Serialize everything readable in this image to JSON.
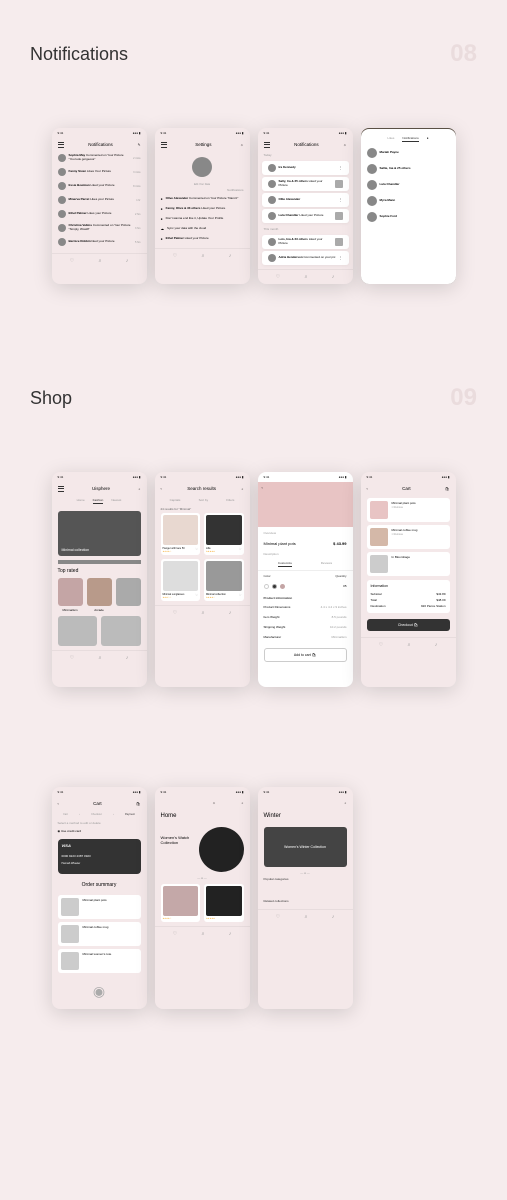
{
  "sections": {
    "notifications": {
      "title": "Notifications",
      "num": "08"
    },
    "shop": {
      "title": "Shop",
      "num": "09"
    }
  },
  "time": "9:41",
  "screens": {
    "notif1": {
      "title": "Notifications",
      "items": [
        {
          "name": "Sophia May",
          "action": "Commented on Your Picture \"You look gorgeous\"",
          "time": "2 mins"
        },
        {
          "name": "Fanny Siven",
          "action": "Likes Your Picture",
          "time": "3 mins"
        },
        {
          "name": "Essie Bowman",
          "action": "Liked your Picture",
          "time": "8 mins"
        },
        {
          "name": "Minerva Parret",
          "action": "Likes your Picture",
          "time": "1 hr"
        },
        {
          "name": "Ethel Palmer",
          "action": "Likes your Picture",
          "time": "2 hrs"
        },
        {
          "name": "Christina Vablos",
          "action": "Commented on Your Picture \"Simply, Wowlll\"",
          "time": "3 hrs"
        },
        {
          "name": "Bernice Robbin",
          "action": "liked your Picture",
          "time": "5 hrs"
        }
      ]
    },
    "settings": {
      "title": "Settings",
      "editBtn": "Edit Your Data",
      "sectionLabel": "Notifications",
      "items": [
        {
          "name": "Olive Alexander",
          "action": "Commented on Your Picture \"Damn!\""
        },
        {
          "name": "Fanny, Olive & 33 others",
          "action": "Liked your Picture"
        },
        {
          "action": "Don't wanna end like it, Update Your Profile"
        },
        {
          "action": "Sync your data with the cloud"
        },
        {
          "name": "Ethel Palmer",
          "action": "Liked your Picture"
        }
      ]
    },
    "notif2": {
      "title": "Notifications",
      "todayLabel": "Today",
      "monthLabel": "This month",
      "today": [
        {
          "name": "Ira Kennedy",
          "action": ""
        },
        {
          "name": "Sally, Ira & 25 others",
          "action": "Liked your Picture"
        },
        {
          "name": "Ollie Alexander",
          "action": ""
        },
        {
          "name": "Lula Chandler",
          "action": "Liked your Picture"
        }
      ],
      "month": [
        {
          "name": "Lois, Ina & 23 others",
          "action": "Liked your Picture"
        },
        {
          "name": "Adria Henderson",
          "action": "Commented on your pic"
        }
      ]
    },
    "profile": {
      "tabLikes": "Likes",
      "tabNotif": "Notifications",
      "users": [
        {
          "name": "Mariah Payne"
        },
        {
          "name": "Sallie, Ina & 25 others"
        },
        {
          "name": "Lula Chandler"
        },
        {
          "name": "Myra Mann"
        },
        {
          "name": "Sophie Ford"
        }
      ]
    },
    "shopHome": {
      "brand": "Uisphere",
      "tabs": [
        "Home",
        "Fashion",
        "Newest"
      ],
      "heroTitle": "Minimal collection",
      "topRated": "Top rated",
      "categories": [
        "Minimalism",
        "Arcade"
      ]
    },
    "search": {
      "title": "Search results",
      "filters": [
        "Capitals",
        "Sort by",
        "Filters"
      ],
      "resultText": "24 results for \"Minimal\"",
      "products": [
        {
          "name": "Hanger with lace 50"
        },
        {
          "name": "Lilla"
        },
        {
          "name": "Minimal sunglasses"
        },
        {
          "name": "Minimal collection"
        }
      ]
    },
    "product": {
      "overline": "Overview",
      "name": "Minimal plant pots",
      "price": "$ 43.99",
      "descLabel": "Description",
      "tabs": [
        "Customize",
        "Reviews"
      ],
      "colorLabel": "Color",
      "qtyLabel": "Quantity",
      "qty": "05",
      "specsLabel": "Product information",
      "specs": [
        {
          "label": "Product Dimensions",
          "val": "4.4 x 4.4 x 9 inches"
        },
        {
          "label": "Item Weight",
          "val": "8.5 pounds"
        },
        {
          "label": "Shipping Weight",
          "val": "10.2 pounds"
        },
        {
          "label": "Manufacturer",
          "val": "Minimalism"
        }
      ],
      "addBtn": "Add to cart"
    },
    "cart": {
      "title": "Cart",
      "items": [
        {
          "name": "Minimal plant pots",
          "remove": "× Remove"
        },
        {
          "name": "Minimal coffee mug",
          "remove": "× Remove"
        },
        {
          "name": "In Bloombage"
        }
      ],
      "infoTitle": "Information",
      "subtotal": {
        "label": "Subtotal",
        "val": "$43.89"
      },
      "total": {
        "label": "Total",
        "val": "$48.09"
      },
      "dest": {
        "label": "Destination",
        "val": "920 Pierce Station"
      },
      "checkoutBtn": "Checkout"
    },
    "home2": {
      "title": "Home",
      "heroTitle": "Women's Watch Collection"
    },
    "winter": {
      "title": "Winter",
      "heroTitle": "Women's Winter Collection",
      "popular": "Popular categories",
      "related": "Related collections"
    },
    "cart2": {
      "title": "Cart",
      "steps": [
        "Cart",
        "Checkout",
        "Payment"
      ],
      "selectMethod": "Select a method to edit or delete",
      "useCard": "Use credit card",
      "cardNum": "0000 9223 2387 0923",
      "cardName": "Hannah Wheeler",
      "summaryTitle": "Order summary",
      "items": [
        {
          "name": "Minimal plant pots"
        },
        {
          "name": "Minimal coffee mug"
        },
        {
          "name": "Minimal women's tote"
        }
      ]
    }
  }
}
